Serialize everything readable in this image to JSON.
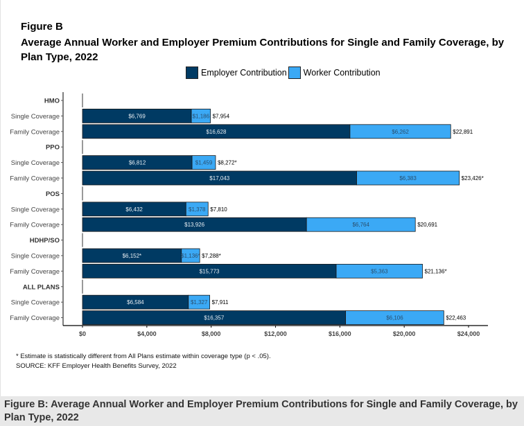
{
  "figure": {
    "label": "Figure B",
    "title": "Average Annual Worker and Employer Premium Contributions for Single and Family Coverage, by Plan Type, 2022"
  },
  "legend": {
    "employer": "Employer Contribution",
    "worker": "Worker Contribution"
  },
  "colors": {
    "employer": "#003a63",
    "worker": "#3ba9f5"
  },
  "footnote": {
    "note": "* Estimate is statistically different from All Plans estimate within coverage type (p < .05).",
    "source": "SOURCE: KFF Employer Health Benefits Survey, 2022"
  },
  "caption": "Figure B: Average Annual Worker and Employer Premium Contributions for Single and Family Coverage, by Plan Type, 2022",
  "chart_data": {
    "type": "bar",
    "orientation": "horizontal",
    "stacked": true,
    "title": "Average Annual Worker and Employer Premium Contributions for Single and Family Coverage, by Plan Type, 2022",
    "xlabel": "",
    "ylabel": "",
    "xlim": [
      0,
      24000
    ],
    "x_ticks": [
      "$0",
      "$4,000",
      "$8,000",
      "$12,000",
      "$16,000",
      "$20,000",
      "$24,000"
    ],
    "x_tick_values": [
      0,
      4000,
      8000,
      12000,
      16000,
      20000,
      24000
    ],
    "legend_position": "top",
    "grid": false,
    "series": [
      {
        "name": "Employer Contribution",
        "key": "employer"
      },
      {
        "name": "Worker Contribution",
        "key": "worker"
      }
    ],
    "rows": [
      {
        "label": "HMO",
        "header": true
      },
      {
        "label": "Single Coverage",
        "employer": 6769,
        "worker": 1186,
        "employer_label": "$6,769",
        "worker_label": "$1,186",
        "total": 7954,
        "total_label": "$7,954"
      },
      {
        "label": "Family Coverage",
        "employer": 16628,
        "worker": 6262,
        "employer_label": "$16,628",
        "worker_label": "$6,262",
        "total": 22891,
        "total_label": "$22,891"
      },
      {
        "label": "PPO",
        "header": true
      },
      {
        "label": "Single Coverage",
        "employer": 6812,
        "worker": 1459,
        "employer_label": "$6,812",
        "worker_label": "$1,459",
        "total": 8272,
        "total_label": "$8,272*"
      },
      {
        "label": "Family Coverage",
        "employer": 17043,
        "worker": 6383,
        "employer_label": "$17,043",
        "worker_label": "$6,383",
        "total": 23426,
        "total_label": "$23,426*"
      },
      {
        "label": "POS",
        "header": true
      },
      {
        "label": "Single Coverage",
        "employer": 6432,
        "worker": 1378,
        "employer_label": "$6,432",
        "worker_label": "$1,378",
        "total": 7810,
        "total_label": "$7,810"
      },
      {
        "label": "Family Coverage",
        "employer": 13926,
        "worker": 6764,
        "employer_label": "$13,926",
        "worker_label": "$6,764",
        "total": 20691,
        "total_label": "$20,691"
      },
      {
        "label": "HDHP/SO",
        "header": true
      },
      {
        "label": "Single Coverage",
        "employer": 6152,
        "worker": 1136,
        "employer_label": "$6,152*",
        "worker_label": "$1,136*",
        "total": 7288,
        "total_label": "$7,288*"
      },
      {
        "label": "Family Coverage",
        "employer": 15773,
        "worker": 5363,
        "employer_label": "$15,773",
        "worker_label": "$5,363",
        "total": 21136,
        "total_label": "$21,136*"
      },
      {
        "label": "ALL PLANS",
        "header": true
      },
      {
        "label": "Single Coverage",
        "employer": 6584,
        "worker": 1327,
        "employer_label": "$6,584",
        "worker_label": "$1,327",
        "total": 7911,
        "total_label": "$7,911"
      },
      {
        "label": "Family Coverage",
        "employer": 16357,
        "worker": 6106,
        "employer_label": "$16,357",
        "worker_label": "$6,106",
        "total": 22463,
        "total_label": "$22,463"
      }
    ]
  }
}
